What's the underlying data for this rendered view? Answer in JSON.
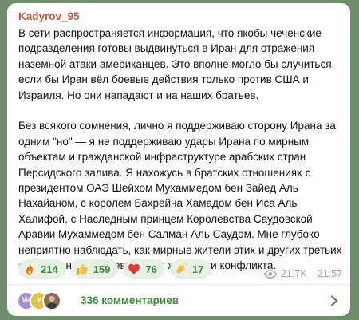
{
  "post": {
    "author": "Kadyrov_95",
    "paragraph1": "В сети распространяется информация, что якобы чеченские подразделения готовы выдвинуться в Иран для отражения наземной атаки американцев. Это вполне могло бы случиться, если бы Иран вёл боевые действия только против США и Израиля. Но они нападают и на наших братьев.",
    "paragraph2": "Без всякого сомнения, лично я поддерживаю сторону Ирана за одним \"но\" — я не поддерживаю удары Ирана по мирным объектам и гражданской инфраструктуре арабских стран Персидского залива. Я нахожусь в братских отношениях с президентом ОАЭ Шейхом Мухаммедом бен Зайед Аль Нахайаном, с королем Бахрейна Хамадом бен Иса Аль Халифой, с Наследным принцем Королевства Саудовской Аравии Мухаммедом бен Салман Аль Саудом. Мне глубоко неприятно наблюдать, как мирные жители этих и других третьих стран становятся невинными жертвами конфликта."
  },
  "reactions": [
    {
      "icon": "fire-emoji",
      "count": "214"
    },
    {
      "icon": "thumbs-up-emoji",
      "count": "159"
    },
    {
      "icon": "red-heart-emoji",
      "count": "76"
    },
    {
      "icon": "clapping-hands-emoji",
      "count": "17"
    }
  ],
  "meta": {
    "views": "21.7K",
    "time": "21:57"
  },
  "comments": {
    "avatar1": "M4",
    "avatar2": "У",
    "label": "336 комментариев"
  },
  "colors": {
    "background": "#6e8f6a",
    "author": "#c65a3f",
    "accent": "#3d8a3d",
    "reaction_bg": "#e7f1e3"
  }
}
